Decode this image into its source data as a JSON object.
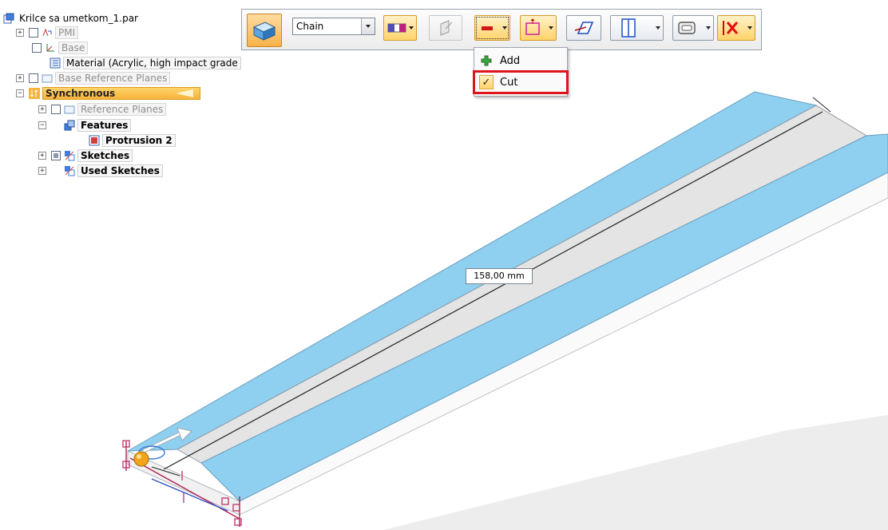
{
  "tree": {
    "root": "Krilce sa umetkom_1.par",
    "pmi": "PMI",
    "base": "Base",
    "material": "Material (Acrylic, high impact grade",
    "base_reference_planes": "Base Reference Planes",
    "synchronous": "Synchronous",
    "reference_planes": "Reference Planes",
    "features": "Features",
    "protrusion": "Protrusion 2",
    "sketches": "Sketches",
    "used_sketches": "Used Sketches",
    "expand_plus": "+",
    "expand_minus": "−"
  },
  "toolbar": {
    "chain_select": "Chain"
  },
  "menu": {
    "add": "Add",
    "cut": "Cut",
    "add_icon": "plus-icon",
    "cut_icon": "checkmark-icon",
    "cut_checked": true
  },
  "viewport": {
    "dimension": "158,00 mm"
  },
  "colors": {
    "face_blue": "#8fd0f0",
    "face_gray": "#e6e6e6",
    "highlight_red": "#e0141b",
    "sync_orange": "#f6b23a"
  }
}
